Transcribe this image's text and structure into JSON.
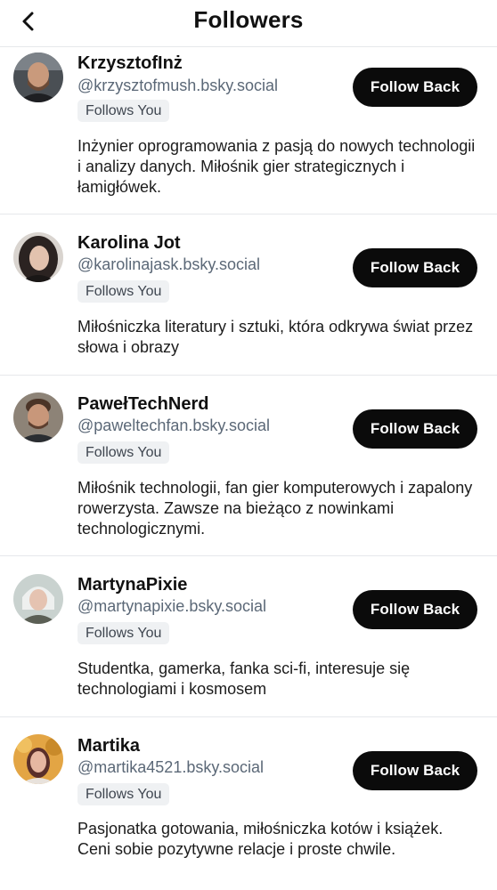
{
  "header": {
    "title": "Followers",
    "back_icon": "chevron-left-icon"
  },
  "followers": [
    {
      "name": "KrzysztofInż",
      "handle": "@krzysztofmush.bsky.social",
      "badge": "Follows You",
      "button": "Follow Back",
      "bio": "Inżynier oprogramowania z pasją do nowych technologii i analizy danych. Miłośnik gier strategicznych i łamigłówek."
    },
    {
      "name": "Karolina Jot",
      "handle": "@karolinajask.bsky.social",
      "badge": "Follows You",
      "button": "Follow Back",
      "bio": "Miłośniczka literatury i sztuki, która odkrywa świat przez słowa i obrazy"
    },
    {
      "name": "PawełTechNerd",
      "handle": "@paweltechfan.bsky.social",
      "badge": "Follows You",
      "button": "Follow Back",
      "bio": "Miłośnik technologii, fan gier komputerowych i zapalony rowerzysta. Zawsze na bieżąco z nowinkami technologicznymi."
    },
    {
      "name": "MartynaPixie",
      "handle": "@martynapixie.bsky.social",
      "badge": "Follows You",
      "button": "Follow Back",
      "bio": "Studentka, gamerka, fanka sci-fi, interesuje się technologiami i kosmosem"
    },
    {
      "name": "Martika",
      "handle": "@martika4521.bsky.social",
      "badge": "Follows You",
      "button": "Follow Back",
      "bio": "Pasjonatka gotowania, miłośniczka kotów i książek. Ceni sobie pozytywne relacje i proste chwile."
    }
  ]
}
